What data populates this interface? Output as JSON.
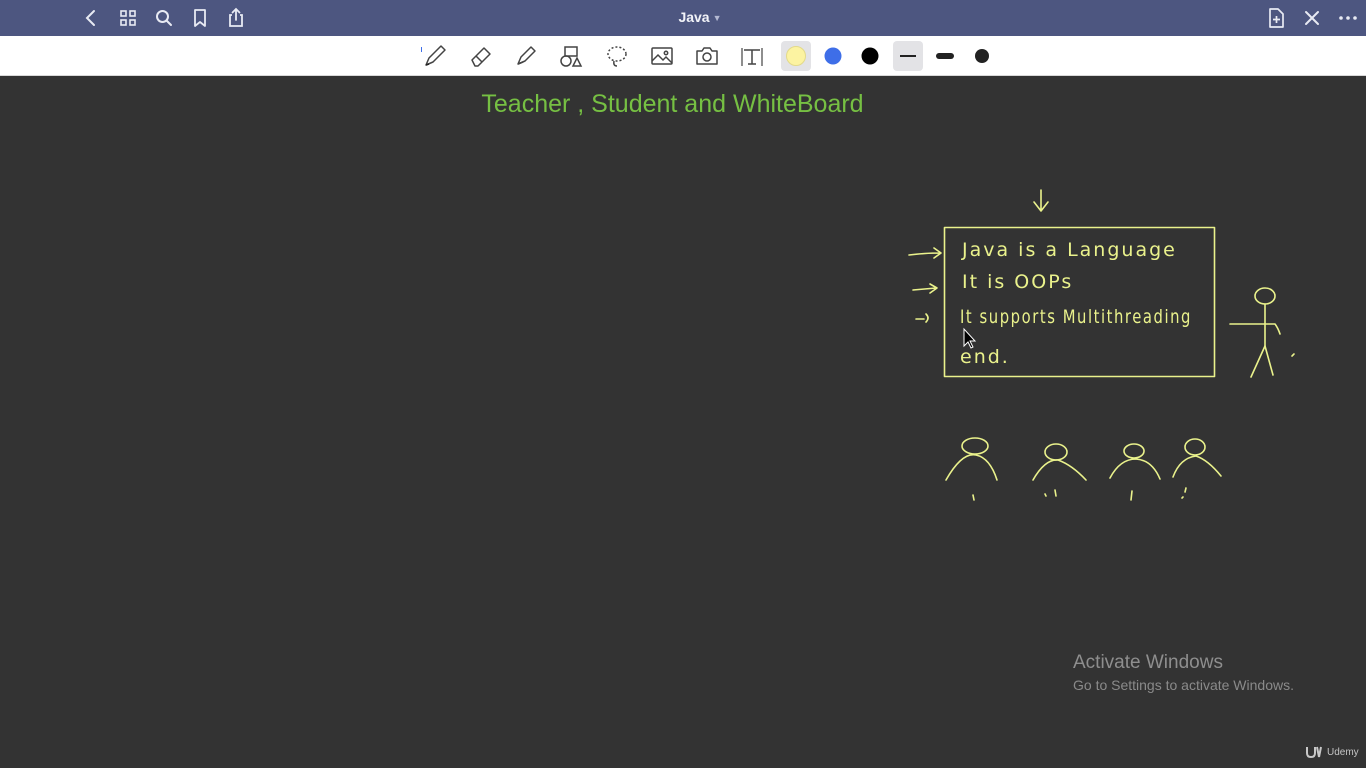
{
  "topbar": {
    "title": "Java",
    "icons": [
      "back-icon",
      "grid-icon",
      "search-icon",
      "bookmark-icon",
      "share-icon",
      "new-page-icon",
      "close-icon",
      "more-icon"
    ]
  },
  "toolbar": {
    "tools": [
      "pen-tool",
      "eraser-tool",
      "highlighter-tool",
      "shapes-tool",
      "lasso-tool",
      "image-tool",
      "camera-tool",
      "text-tool"
    ],
    "colors": [
      "#fcf3a1",
      "#3e6ee8",
      "#000000"
    ],
    "selected_stroke": "thin",
    "stroke_sizes": [
      "thin",
      "medium",
      "thick"
    ]
  },
  "canvas": {
    "title": "Teacher , Student and WhiteBoard",
    "title_color": "#76c043",
    "ink_color": "#eaf28c",
    "board_lines": [
      "Java is a Language",
      "It is OOPs",
      "It supports Multithreading",
      "end."
    ]
  },
  "watermark": {
    "title": "Activate Windows",
    "subtitle": "Go to Settings to activate Windows.",
    "brand": "Udemy"
  }
}
